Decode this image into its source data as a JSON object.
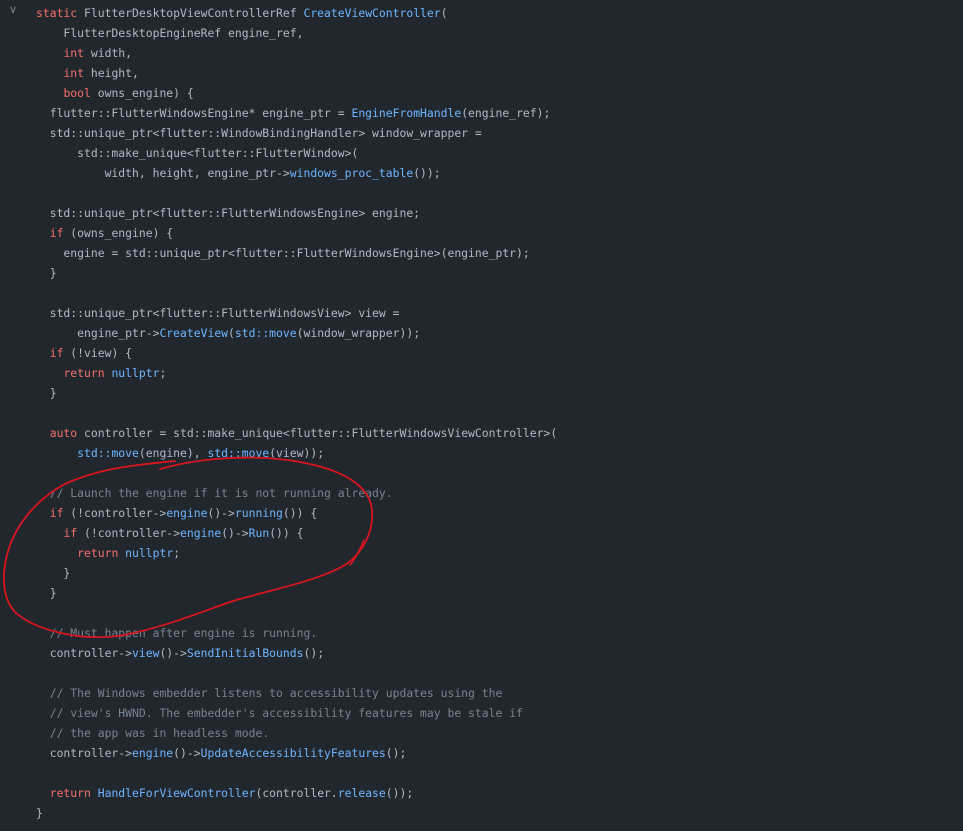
{
  "editor": {
    "lines": [
      [
        [
          "kw",
          "static "
        ],
        [
          "tx",
          "FlutterDesktopViewControllerRef "
        ],
        [
          "fn",
          "CreateViewController"
        ],
        [
          "tx",
          "("
        ]
      ],
      [
        [
          "tx",
          "    FlutterDesktopEngineRef engine_ref,"
        ]
      ],
      [
        [
          "tx",
          "    "
        ],
        [
          "kw",
          "int"
        ],
        [
          "tx",
          " width,"
        ]
      ],
      [
        [
          "tx",
          "    "
        ],
        [
          "kw",
          "int"
        ],
        [
          "tx",
          " height,"
        ]
      ],
      [
        [
          "tx",
          "    "
        ],
        [
          "kw",
          "bool"
        ],
        [
          "tx",
          " owns_engine) {"
        ]
      ],
      [
        [
          "tx",
          "  flutter::FlutterWindowsEngine* engine_ptr = "
        ],
        [
          "fn",
          "EngineFromHandle"
        ],
        [
          "tx",
          "(engine_ref);"
        ]
      ],
      [
        [
          "tx",
          "  std::unique_ptr<flutter::WindowBindingHandler> window_wrapper ="
        ]
      ],
      [
        [
          "tx",
          "      std::make_unique<flutter::FlutterWindow>("
        ]
      ],
      [
        [
          "tx",
          "          width, height, engine_ptr->"
        ],
        [
          "fn",
          "windows_proc_table"
        ],
        [
          "tx",
          "());"
        ]
      ],
      [],
      [
        [
          "tx",
          "  std::unique_ptr<flutter::FlutterWindowsEngine> engine;"
        ]
      ],
      [
        [
          "tx",
          "  "
        ],
        [
          "kw",
          "if"
        ],
        [
          "tx",
          " (owns_engine) {"
        ]
      ],
      [
        [
          "tx",
          "    engine = std::unique_ptr<flutter::FlutterWindowsEngine>(engine_ptr);"
        ]
      ],
      [
        [
          "tx",
          "  }"
        ]
      ],
      [],
      [
        [
          "tx",
          "  std::unique_ptr<flutter::FlutterWindowsView> view ="
        ]
      ],
      [
        [
          "tx",
          "      engine_ptr->"
        ],
        [
          "fn",
          "CreateView"
        ],
        [
          "tx",
          "("
        ],
        [
          "fn",
          "std::move"
        ],
        [
          "tx",
          "(window_wrapper));"
        ]
      ],
      [
        [
          "tx",
          "  "
        ],
        [
          "kw",
          "if"
        ],
        [
          "tx",
          " (!view) {"
        ]
      ],
      [
        [
          "tx",
          "    "
        ],
        [
          "kw",
          "return"
        ],
        [
          "tx",
          " "
        ],
        [
          "fn",
          "nullptr"
        ],
        [
          "tx",
          ";"
        ]
      ],
      [
        [
          "tx",
          "  }"
        ]
      ],
      [],
      [
        [
          "tx",
          "  "
        ],
        [
          "kw",
          "auto"
        ],
        [
          "tx",
          " controller = std::make_unique<flutter::FlutterWindowsViewController>("
        ]
      ],
      [
        [
          "tx",
          "      "
        ],
        [
          "fn",
          "std::move"
        ],
        [
          "tx",
          "(engine), "
        ],
        [
          "fn",
          "std::move"
        ],
        [
          "tx",
          "(view));"
        ]
      ],
      [],
      [
        [
          "tx",
          "  "
        ],
        [
          "cm",
          "// Launch the engine if it is not running already."
        ]
      ],
      [
        [
          "tx",
          "  "
        ],
        [
          "kw",
          "if"
        ],
        [
          "tx",
          " (!controller->"
        ],
        [
          "fn",
          "engine"
        ],
        [
          "tx",
          "()->"
        ],
        [
          "fn",
          "running"
        ],
        [
          "tx",
          "()) {"
        ]
      ],
      [
        [
          "tx",
          "    "
        ],
        [
          "kw",
          "if"
        ],
        [
          "tx",
          " (!controller->"
        ],
        [
          "fn",
          "engine"
        ],
        [
          "tx",
          "()->"
        ],
        [
          "fn",
          "Run"
        ],
        [
          "tx",
          "()) {"
        ]
      ],
      [
        [
          "tx",
          "      "
        ],
        [
          "kw",
          "return"
        ],
        [
          "tx",
          " "
        ],
        [
          "fn",
          "nullptr"
        ],
        [
          "tx",
          ";"
        ]
      ],
      [
        [
          "tx",
          "    }"
        ]
      ],
      [
        [
          "tx",
          "  }"
        ]
      ],
      [],
      [
        [
          "tx",
          "  "
        ],
        [
          "cm",
          "// Must happen after engine is running."
        ]
      ],
      [
        [
          "tx",
          "  controller->"
        ],
        [
          "fn",
          "view"
        ],
        [
          "tx",
          "()->"
        ],
        [
          "fn",
          "SendInitialBounds"
        ],
        [
          "tx",
          "();"
        ]
      ],
      [],
      [
        [
          "tx",
          "  "
        ],
        [
          "cm",
          "// The Windows embedder listens to accessibility updates using the"
        ]
      ],
      [
        [
          "tx",
          "  "
        ],
        [
          "cm",
          "// view's HWND. The embedder's accessibility features may be stale if"
        ]
      ],
      [
        [
          "tx",
          "  "
        ],
        [
          "cm",
          "// the app was in headless mode."
        ]
      ],
      [
        [
          "tx",
          "  controller->"
        ],
        [
          "fn",
          "engine"
        ],
        [
          "tx",
          "()->"
        ],
        [
          "fn",
          "UpdateAccessibilityFeatures"
        ],
        [
          "tx",
          "();"
        ]
      ],
      [],
      [
        [
          "tx",
          "  "
        ],
        [
          "kw",
          "return"
        ],
        [
          "tx",
          " "
        ],
        [
          "fn",
          "HandleForViewController"
        ],
        [
          "tx",
          "(controller."
        ],
        [
          "fn",
          "release"
        ],
        [
          "tx",
          "());"
        ]
      ],
      [
        [
          "tx",
          "}"
        ]
      ]
    ]
  },
  "fold_icon": "chevron-down-icon",
  "fold_glyph": "∨",
  "colors": {
    "background": "#22272e",
    "keyword": "#f47067",
    "function": "#6cb6ff",
    "comment": "#768390",
    "text": "#adbac7",
    "annotation": "#d8151f"
  }
}
